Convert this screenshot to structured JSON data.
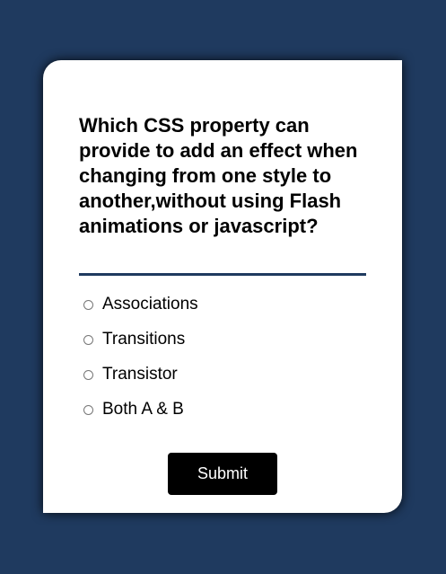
{
  "quiz": {
    "question": "Which CSS property can provide to add an effect when changing from one style to another,without using Flash animations or javascript?",
    "options": [
      {
        "label": "Associations",
        "selected": false
      },
      {
        "label": "Transitions",
        "selected": false
      },
      {
        "label": "Transistor",
        "selected": false
      },
      {
        "label": "Both A & B",
        "selected": false
      }
    ],
    "submit_label": "Submit"
  },
  "colors": {
    "page_background": "#1f3a5f",
    "card_background": "#ffffff",
    "divider": "#1f3a5f",
    "button_background": "#000000",
    "button_text": "#ffffff"
  }
}
